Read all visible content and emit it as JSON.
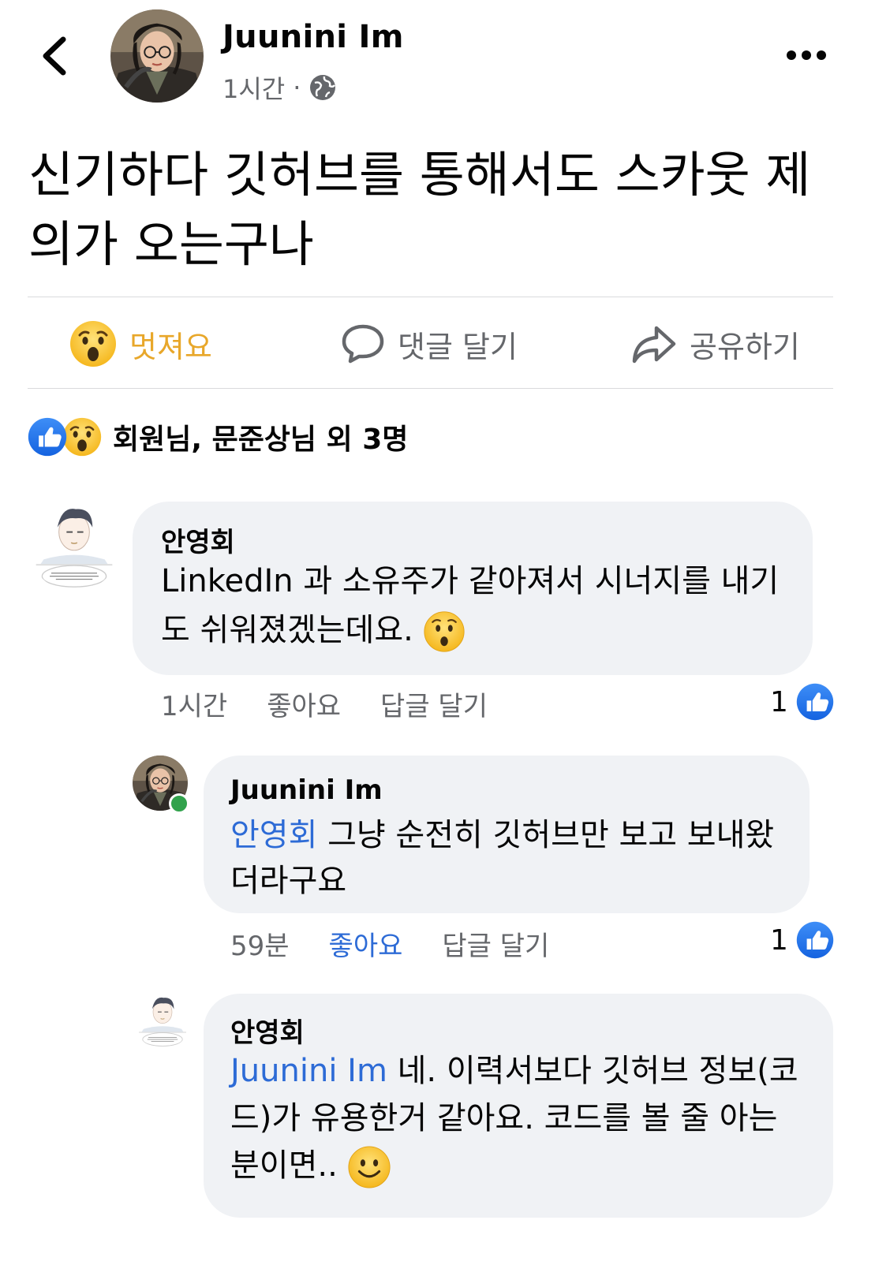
{
  "post": {
    "author": "Juunini Im",
    "time": "1시간",
    "separator": "·",
    "text": "신기하다 깃허브를 통해서도 스카웃 제의가 오는구나"
  },
  "actions": {
    "wow_label": "멋져요",
    "comment_label": "댓글 달기",
    "share_label": "공유하기"
  },
  "reactions": {
    "summary": "회원님, 문준상님 외 3명",
    "icons": [
      "like-icon",
      "wow-icon"
    ]
  },
  "comments": [
    {
      "author": "안영회",
      "text": "LinkedIn 과 소유주가 같아져서 시너지를 내기도 쉬워졌겠는데요.",
      "emoji": "hushed-emoji",
      "time": "1시간",
      "like_label": "좋아요",
      "reply_label": "답글 달기",
      "like_count": "1"
    },
    {
      "author": "Juunini Im",
      "mention": "안영회",
      "text": " 그냥 순전히 깃허브만 보고 보내왔더라구요",
      "time": "59분",
      "like_label": "좋아요",
      "reply_label": "답글 달기",
      "like_count": "1",
      "liked": true
    },
    {
      "author": "안영회",
      "mention": "Juunini Im",
      "text": " 네. 이력서보다 깃허브 정보(코드)가 유용한거 같아요. 코드를 볼 줄 아는 분이면..",
      "emoji": "smile-emoji"
    }
  ],
  "colors": {
    "mention": "#2d6bd6",
    "wow": "#e8a72a",
    "bubble": "#f0f2f5",
    "secondary_text": "#65676b",
    "online": "#31a24c",
    "like_blue": "#1877f2"
  }
}
